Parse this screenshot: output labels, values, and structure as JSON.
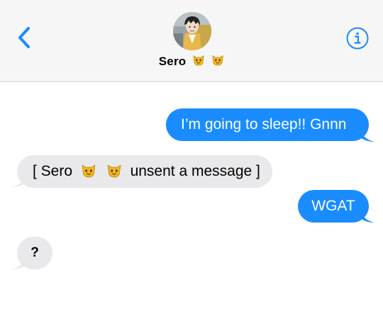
{
  "contact": {
    "name": "Sero",
    "name_emojis": [
      "cat-face",
      "cat-face"
    ]
  },
  "messages": [
    {
      "direction": "outgoing",
      "text": "I’m going to sleep!! Gnnn"
    },
    {
      "direction": "incoming",
      "text_before": "[ Sero",
      "emojis": [
        "cat-face",
        "cat-face"
      ],
      "text_after": "unsent a message ]"
    },
    {
      "direction": "outgoing",
      "text": "WGAT"
    },
    {
      "direction": "incoming",
      "text": "?"
    }
  ],
  "colors": {
    "accent": "#1a8cff",
    "outgoing_bubble": "#1a8cff",
    "incoming_bubble": "#e9e9eb",
    "header_bg": "#f6f6f6"
  }
}
